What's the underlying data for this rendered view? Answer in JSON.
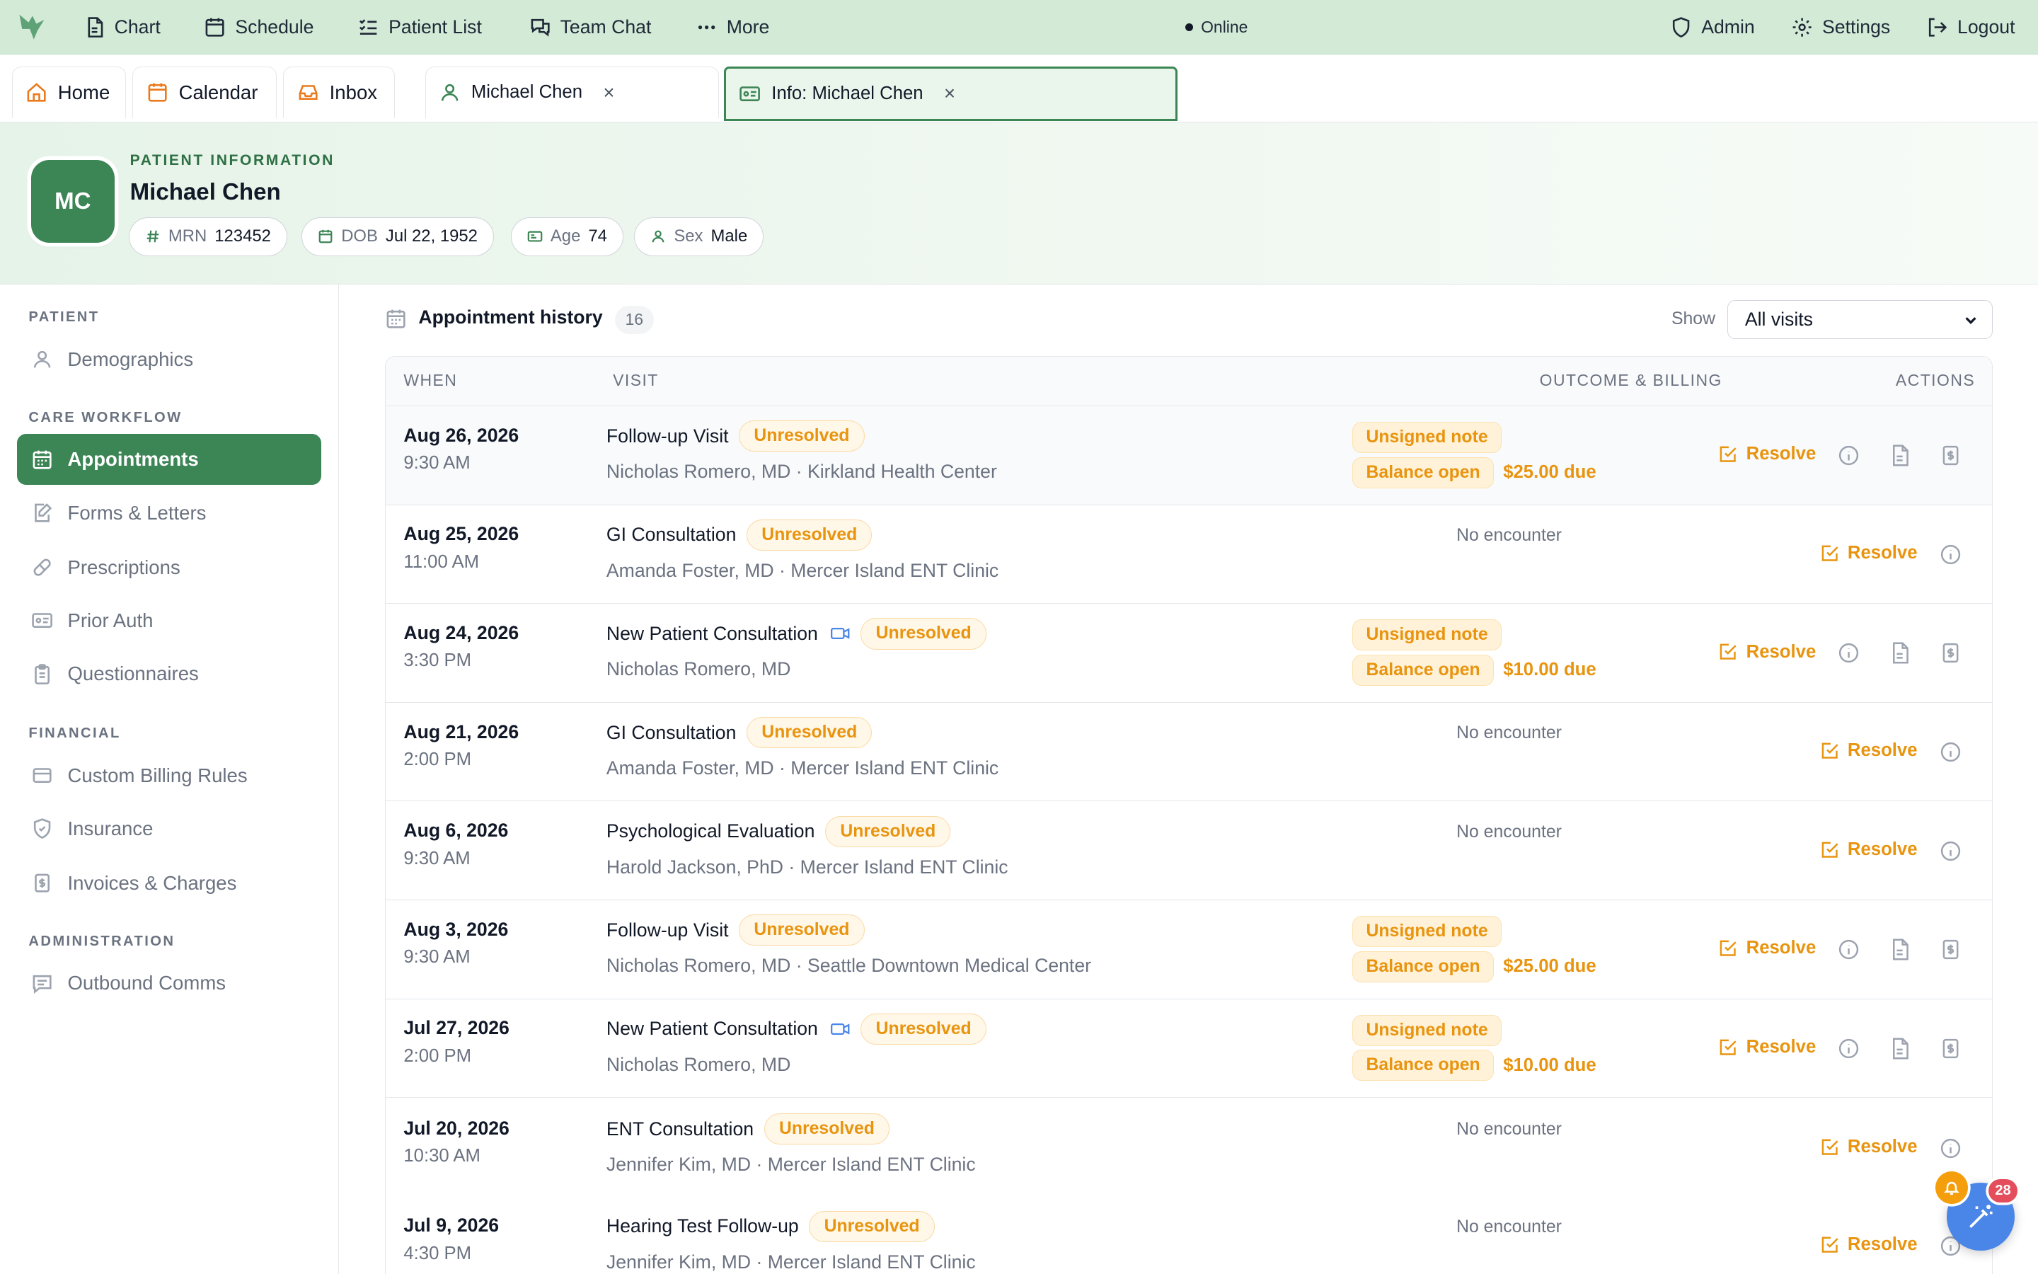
{
  "topnav": {
    "items": [
      {
        "label": "Chart",
        "icon": "chart-icon"
      },
      {
        "label": "Schedule",
        "icon": "calendar-icon"
      },
      {
        "label": "Patient List",
        "icon": "list-icon"
      },
      {
        "label": "Team Chat",
        "icon": "chat-icon"
      },
      {
        "label": "More",
        "icon": "more-icon"
      }
    ],
    "status": "Online",
    "right": [
      {
        "label": "Admin",
        "icon": "shield-icon"
      },
      {
        "label": "Settings",
        "icon": "gear-icon"
      },
      {
        "label": "Logout",
        "icon": "logout-icon"
      }
    ]
  },
  "tabs": [
    {
      "label": "Home",
      "icon": "home-icon"
    },
    {
      "label": "Calendar",
      "icon": "calendar-icon"
    },
    {
      "label": "Inbox",
      "icon": "inbox-icon"
    },
    {
      "label": "Michael Chen",
      "icon": "user-icon",
      "close": "×"
    },
    {
      "label": "Info: Michael Chen",
      "icon": "id-card-icon",
      "close": "×"
    }
  ],
  "patient": {
    "section_label": "PATIENT INFORMATION",
    "initials": "MC",
    "name": "Michael Chen",
    "chips": [
      {
        "key": "MRN",
        "value": "123452",
        "icon": "hash-icon"
      },
      {
        "key": "DOB",
        "value": "Jul 22, 1952",
        "icon": "calendar-icon"
      },
      {
        "key": "Age",
        "value": "74",
        "icon": "id-card-icon"
      },
      {
        "key": "Sex",
        "value": "Male",
        "icon": "user-icon"
      }
    ]
  },
  "sidebar": {
    "sections": [
      {
        "label": "PATIENT"
      },
      {
        "label": "CARE WORKFLOW"
      },
      {
        "label": "FINANCIAL"
      },
      {
        "label": "ADMINISTRATION"
      }
    ],
    "items": [
      {
        "label": "Demographics",
        "icon": "user-icon"
      },
      {
        "label": "Appointments",
        "icon": "calendar-icon"
      },
      {
        "label": "Forms & Letters",
        "icon": "form-icon"
      },
      {
        "label": "Prescriptions",
        "icon": "pill-icon"
      },
      {
        "label": "Prior Auth",
        "icon": "id-card-icon"
      },
      {
        "label": "Questionnaires",
        "icon": "clipboard-icon"
      },
      {
        "label": "Custom Billing Rules",
        "icon": "card-icon"
      },
      {
        "label": "Insurance",
        "icon": "shield-check-icon"
      },
      {
        "label": "Invoices & Charges",
        "icon": "invoice-icon"
      },
      {
        "label": "Outbound Comms",
        "icon": "message-icon"
      }
    ]
  },
  "main": {
    "title": "Appointment history",
    "count": "16",
    "show_label": "Show",
    "show_value": "All visits",
    "columns": [
      "WHEN",
      "VISIT",
      "OUTCOME & BILLING",
      "ACTIONS"
    ],
    "unsigned_label": "Unsigned note",
    "balance_label": "Balance open",
    "no_encounter": "No encounter",
    "resolve_label": "Resolve",
    "rows": [
      {
        "date": "Aug 26, 2026",
        "time": "9:30 AM",
        "visit": "Follow-up Visit",
        "status": "Unresolved",
        "provider": "Nicholas Romero, MD · Kirkland Health Center",
        "video": false,
        "billing": true,
        "due": "$25.00 due"
      },
      {
        "date": "Aug 25, 2026",
        "time": "11:00 AM",
        "visit": "GI Consultation",
        "status": "Unresolved",
        "provider": "Amanda Foster, MD · Mercer Island ENT Clinic",
        "video": false,
        "billing": false
      },
      {
        "date": "Aug 24, 2026",
        "time": "3:30 PM",
        "visit": "New Patient Consultation",
        "status": "Unresolved",
        "provider": "Nicholas Romero, MD",
        "video": true,
        "billing": true,
        "due": "$10.00 due"
      },
      {
        "date": "Aug 21, 2026",
        "time": "2:00 PM",
        "visit": "GI Consultation",
        "status": "Unresolved",
        "provider": "Amanda Foster, MD · Mercer Island ENT Clinic",
        "video": false,
        "billing": false
      },
      {
        "date": "Aug 6, 2026",
        "time": "9:30 AM",
        "visit": "Psychological Evaluation",
        "status": "Unresolved",
        "provider": "Harold Jackson, PhD · Mercer Island ENT Clinic",
        "video": false,
        "billing": false
      },
      {
        "date": "Aug 3, 2026",
        "time": "9:30 AM",
        "visit": "Follow-up Visit",
        "status": "Unresolved",
        "provider": "Nicholas Romero, MD · Seattle Downtown Medical Center",
        "video": false,
        "billing": true,
        "due": "$25.00 due"
      },
      {
        "date": "Jul 27, 2026",
        "time": "2:00 PM",
        "visit": "New Patient Consultation",
        "status": "Unresolved",
        "provider": "Nicholas Romero, MD",
        "video": true,
        "billing": true,
        "due": "$10.00 due"
      },
      {
        "date": "Jul 20, 2026",
        "time": "10:30 AM",
        "visit": "ENT Consultation",
        "status": "Unresolved",
        "provider": "Jennifer Kim, MD · Mercer Island ENT Clinic",
        "video": false,
        "billing": false
      },
      {
        "date": "Jul 9, 2026",
        "time": "4:30 PM",
        "visit": "Hearing Test Follow-up",
        "status": "Unresolved",
        "provider": "Jennifer Kim, MD · Mercer Island ENT Clinic",
        "video": false,
        "billing": false
      }
    ]
  },
  "floating": {
    "notification_count": "28"
  },
  "colors": {
    "brand": "#3c8555",
    "topbar": "#d2ead6",
    "warning": "#e8940f",
    "assistant": "#4a86e8",
    "notif": "#e44d5b"
  }
}
